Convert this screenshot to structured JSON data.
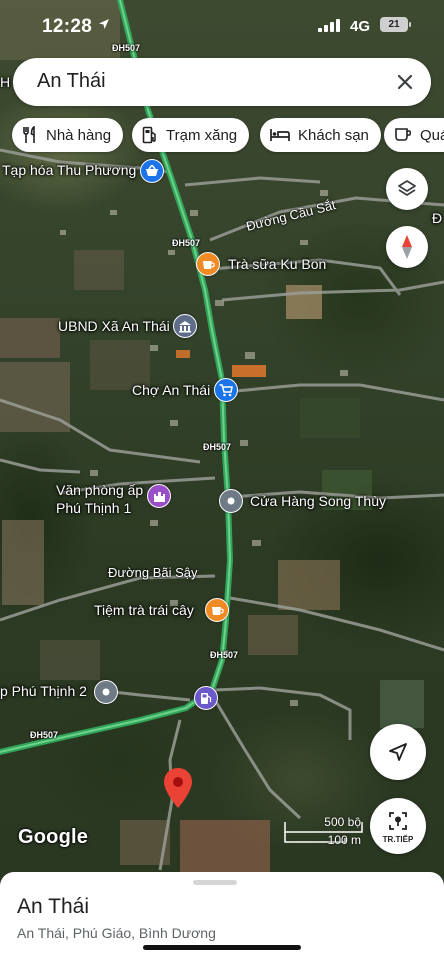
{
  "status_bar": {
    "time": "12:28",
    "network": "4G",
    "battery": "21"
  },
  "search": {
    "query": "An Thái"
  },
  "chips": [
    {
      "label": "Nhà hàng",
      "icon": "fork-knife-icon"
    },
    {
      "label": "Trạm xăng",
      "icon": "gas-station-icon"
    },
    {
      "label": "Khách sạn",
      "icon": "bed-icon"
    },
    {
      "label": "Quá",
      "icon": "coffee-cup-icon"
    }
  ],
  "map": {
    "places": [
      {
        "name": "Tạp hóa Thu Phương",
        "icon": "shopping-basket-icon",
        "color": "#1a73e8"
      },
      {
        "name": "Trà sữa Ku Bon",
        "icon": "cup-icon",
        "color": "#f08a24"
      },
      {
        "name": "UBND Xã An Thái",
        "icon": "government-building-icon",
        "color": "#5f6d8a"
      },
      {
        "name": "Chợ An Thái",
        "icon": "shopping-cart-icon",
        "color": "#1a73e8"
      },
      {
        "name": "Văn phòng ấp Phú Thịnh 1",
        "icon": "castle-icon",
        "color": "#9a4fc9"
      },
      {
        "name": "Cửa Hàng Song Thùy",
        "icon": "place-dot-icon",
        "color": "#6f7a87"
      },
      {
        "name": "Tiệm trà trái cây",
        "icon": "cup-icon",
        "color": "#f08a24"
      },
      {
        "name": "p Phú Thịnh 2",
        "icon": "place-dot-icon",
        "color": "#6f7a87"
      },
      {
        "name": "",
        "icon": "gas-station-icon",
        "color": "#6b58c9"
      }
    ],
    "roads": [
      "Đường Cầu Sắt",
      "Đường Bãi Sậy"
    ],
    "route_shields": [
      "ĐH507",
      "ĐH507",
      "ĐH507",
      "ĐH507",
      "ĐH507"
    ],
    "edge_labels": [
      "H",
      "Đ"
    ],
    "scale": {
      "imperial": "500 bộ",
      "metric": "100 m"
    },
    "attribution": "Google",
    "destination_pin_color": "#ea4335"
  },
  "controls": {
    "layers": "layers-icon",
    "compass": "compass-icon",
    "my_location": "navigation-arrow-icon",
    "street_view_label": "TR.TIẾP"
  },
  "sheet": {
    "title": "An Thái",
    "subtitle": "An Thái, Phú Giáo, Bình Dương"
  }
}
